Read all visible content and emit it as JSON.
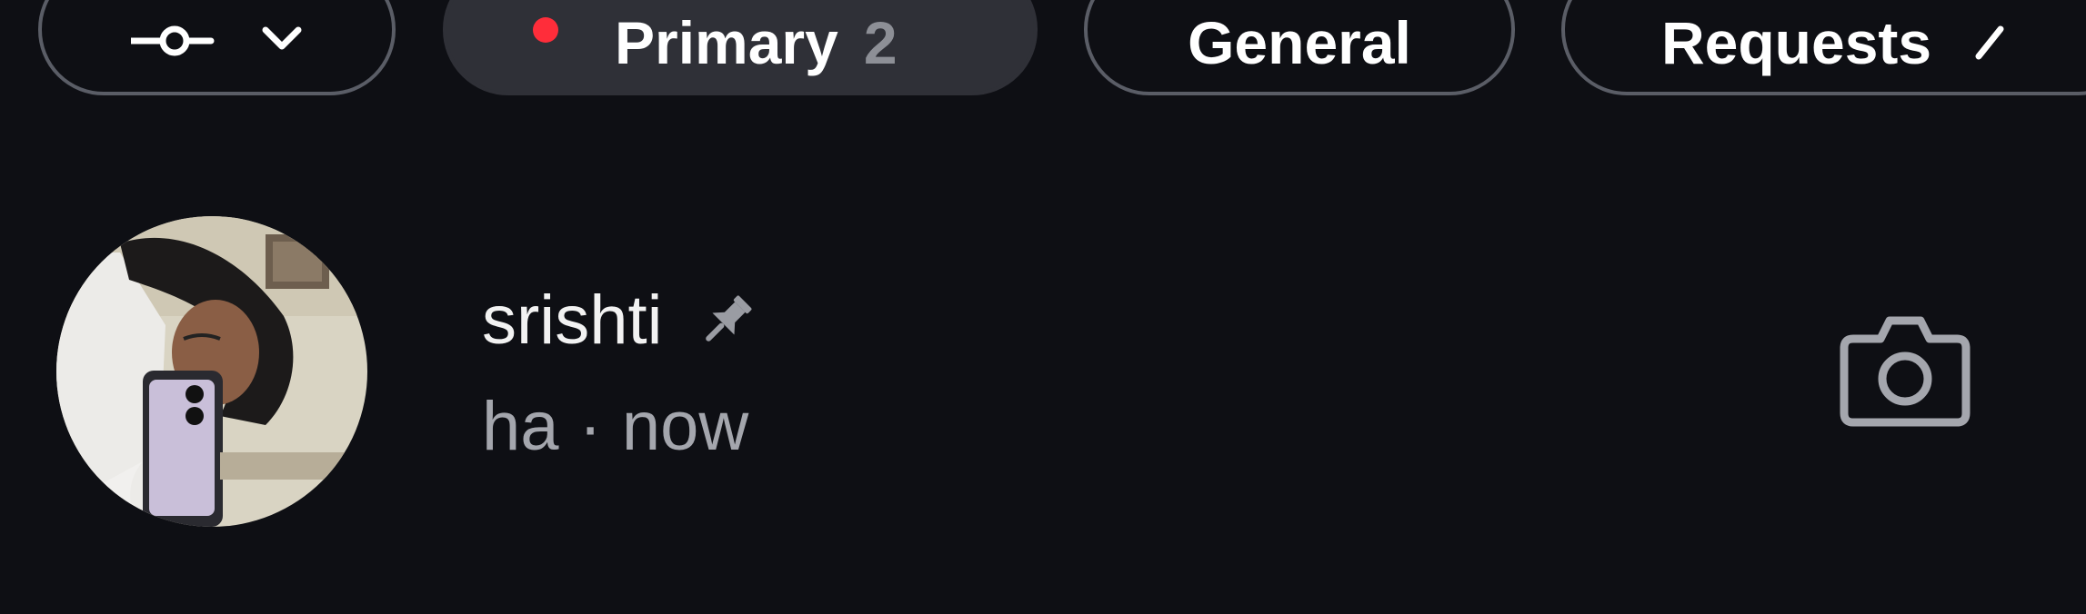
{
  "filters": {
    "primary_label": "Primary",
    "primary_count": "2",
    "general_label": "General",
    "requests_label": "Requests"
  },
  "thread": {
    "name": "srishti",
    "preview": "ha",
    "separator": "·",
    "time": "now"
  },
  "icons": {
    "filter": "filter-slider-icon",
    "dropdown": "chevron-down-icon",
    "requests_arrow": "chevron-right-icon",
    "pin": "pin-icon",
    "camera": "camera-icon",
    "avatar": "profile-photo"
  },
  "colors": {
    "background": "#0e0f14",
    "chip_border": "#5a5d66",
    "chip_active_bg": "#2f3037",
    "unread_dot": "#ff2d3a",
    "secondary_text": "#a4a6ad"
  }
}
